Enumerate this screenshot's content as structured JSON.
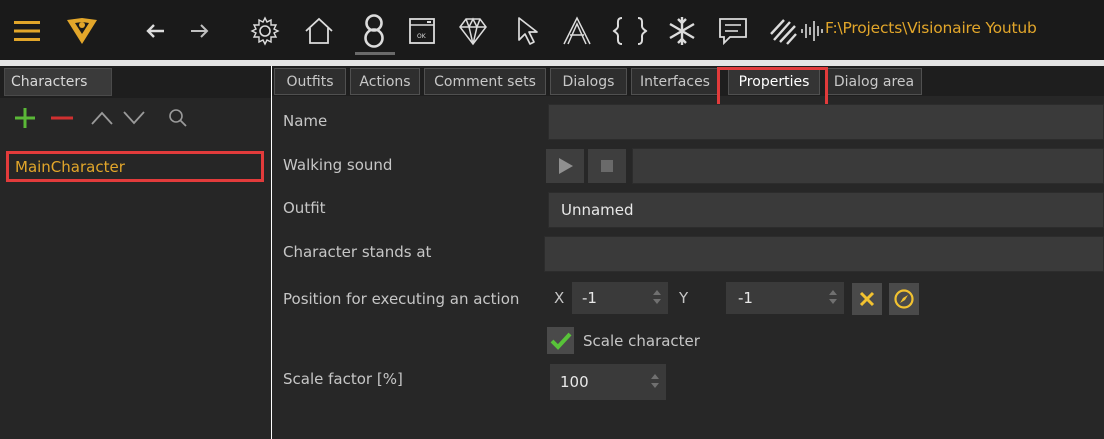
{
  "toolbar": {
    "path": "F:\\Projects\\Visionaire Youtub",
    "icons": [
      "menu-icon",
      "visionaire-logo-icon",
      "back-arrow-icon",
      "forward-arrow-icon",
      "settings-gear-icon",
      "home-icon",
      "character-icon",
      "window-icon",
      "diamond-icon",
      "cursor-icon",
      "font-icon",
      "braces-icon",
      "snowflake-icon",
      "comment-icon",
      "pattern-icon",
      "audio-wave-icon"
    ]
  },
  "left_panel": {
    "tab_label": "Characters",
    "items": [
      {
        "label": "MainCharacter"
      }
    ]
  },
  "tabs": [
    {
      "label": "Outfits"
    },
    {
      "label": "Actions"
    },
    {
      "label": "Comment sets"
    },
    {
      "label": "Dialogs"
    },
    {
      "label": "Interfaces"
    },
    {
      "label": "Properties"
    },
    {
      "label": "Dialog area"
    }
  ],
  "active_tab": "Properties",
  "properties": {
    "name_label": "Name",
    "name_value": "",
    "walking_sound_label": "Walking sound",
    "walking_sound_value": "",
    "outfit_label": "Outfit",
    "outfit_value": "Unnamed",
    "stands_at_label": "Character stands at",
    "stands_at_value": "",
    "position_label": "Position for executing an action",
    "x_label": "X",
    "x_value": "-1",
    "y_label": "Y",
    "y_value": "-1",
    "scale_character_label": "Scale character",
    "scale_character_checked": true,
    "scale_factor_label": "Scale factor [%]",
    "scale_factor_value": "100"
  },
  "colors": {
    "accent_orange": "#e2a62a",
    "highlight_red": "#e23b3b",
    "add_green": "#5ab837",
    "remove_red": "#d03030",
    "check_green": "#58c339",
    "action_yellow": "#f2c230"
  }
}
